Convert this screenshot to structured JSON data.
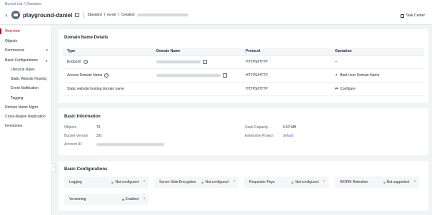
{
  "breadcrumb": {
    "root": "Bucket List",
    "separator": "/",
    "current": "Overview"
  },
  "header": {
    "bucket_name": "playground-daniel",
    "storage_class": "Standard",
    "region": "eu-de",
    "created_label": "Created:",
    "task_center": "Task Center"
  },
  "sidebar": {
    "overview": "Overview",
    "objects": "Objects",
    "permissions": "Permissions",
    "basic_configurations": "Basic Configurations",
    "lifecycle_rules": "Lifecycle Rules",
    "static_website_hosting": "Static Website Hosting",
    "event_notification": "Event Notification",
    "tagging": "Tagging",
    "domain_name_mgmt": "Domain Name Mgmt",
    "cross_region_replication": "Cross-Region Replication",
    "inventories": "Inventories",
    "caret": "▾",
    "collapse": "‹"
  },
  "domain_details": {
    "title": "Domain Name Details",
    "columns": {
      "type": "Type",
      "domain": "Domain Name",
      "protocol": "Protocol",
      "operation": "Operation"
    },
    "rows": [
      {
        "type": "Endpoint",
        "protocol": "HTTPS/HTTP",
        "operation": "--"
      },
      {
        "type": "Access Domain Name",
        "protocol": "HTTPS/HTTP",
        "operation": "Bind User Domain Name"
      },
      {
        "type": "Static website hosting domain name",
        "protocol": "HTTPS/HTTP",
        "operation": "Configure"
      }
    ]
  },
  "basic_info": {
    "title": "Basic Information",
    "objects_label": "Objects",
    "objects_value": "76",
    "bucket_version_label": "Bucket Version",
    "bucket_version_value": "3.0",
    "account_id_label": "Account ID",
    "used_capacity_label": "Used Capacity",
    "used_capacity_value": "4.52 MB",
    "enterprise_project_label": "Enterprise Project",
    "enterprise_project_value": "default"
  },
  "basic_configs": {
    "title": "Basic Configurations",
    "tiles": [
      {
        "label": "Logging",
        "status": "Not configured"
      },
      {
        "label": "Server-Side Encryption",
        "status": "Not configured"
      },
      {
        "label": "Requester Pays",
        "status": "Not configured"
      },
      {
        "label": "WORM Retention",
        "status": "Not supported"
      },
      {
        "label": "Versioning",
        "status": "Enabled"
      }
    ],
    "arrow": "›"
  },
  "icons": {
    "back": "‹",
    "help": "?",
    "link": "⚭",
    "configure": "⇄"
  },
  "colors": {
    "accent": "#c7000b",
    "link": "#526ecc",
    "enabled": "#50b56f"
  }
}
